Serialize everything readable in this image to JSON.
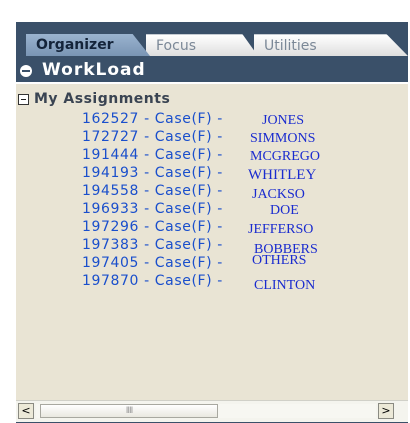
{
  "tabs": [
    {
      "label": "Organizer",
      "active": true
    },
    {
      "label": "Focus",
      "active": false
    },
    {
      "label": "Utilities",
      "active": false
    }
  ],
  "section": {
    "title": "WorkLoad"
  },
  "group": {
    "label": "My Assignments"
  },
  "assignments": [
    {
      "case": "162527 - Case(F) -",
      "name": "JONES"
    },
    {
      "case": "172727 - Case(F) -",
      "name": "SIMMONS"
    },
    {
      "case": "191444 - Case(F) -",
      "name": "MCGREGO"
    },
    {
      "case": "194193 - Case(F) -",
      "name": "WHITLEY"
    },
    {
      "case": "194558 - Case(F) -",
      "name": "JACKSO"
    },
    {
      "case": "196933 - Case(F) -",
      "name": "DOE"
    },
    {
      "case": "197296 - Case(F) -",
      "name": "JEFFERSO"
    },
    {
      "case": "197383 - Case(F) -",
      "name": "BOBBERS"
    },
    {
      "case": "197405 - Case(F) -",
      "name": "OTHERS"
    },
    {
      "case": "197870 - Case(F) -",
      "name": "CLINTON"
    }
  ],
  "scrollbar": {
    "left_arrow": "<",
    "right_arrow": ">",
    "thumb_grip": "IIII"
  },
  "colors": {
    "panel": "#3a5069",
    "content_bg": "#e9e4d4",
    "link_blue": "#1a4fcc",
    "name_blue": "#1a2bcf"
  }
}
